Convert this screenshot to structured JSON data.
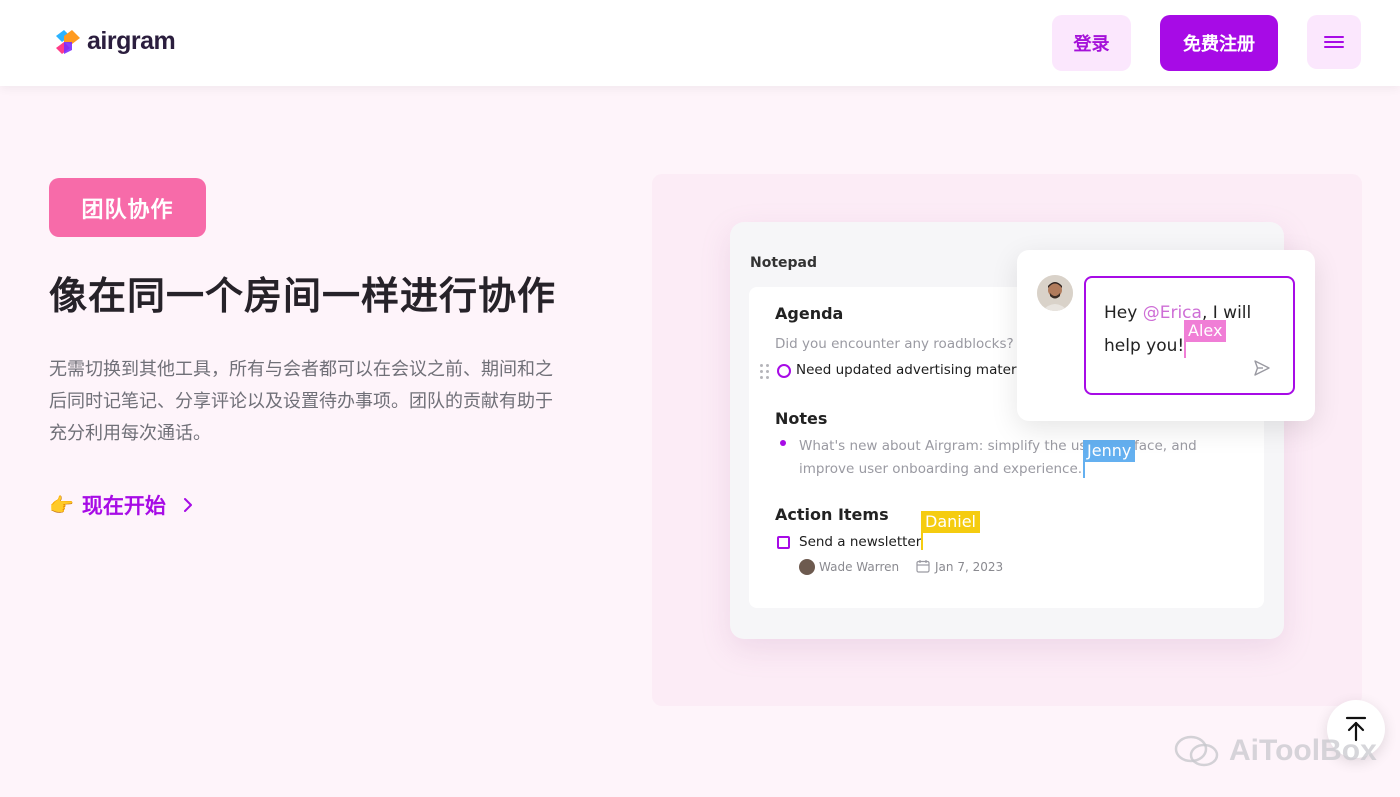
{
  "header": {
    "logo_text": "airgram",
    "login_label": "登录",
    "register_label": "免费注册",
    "menu_icon": "hamburger-menu-icon"
  },
  "hero": {
    "tag": "团队协作",
    "title": "像在同一个房间一样进行协作",
    "description": "无需切换到其他工具，所有与会者都可以在会议之前、期间和之后同时记笔记、分享评论以及设置待办事项。团队的贡献有助于充分利用每次通话。",
    "cta_emoji": "👉",
    "cta_label": "现在开始"
  },
  "notepad": {
    "title": "Notepad",
    "agenda": {
      "heading": "Agenda",
      "question": "Did you encounter any roadblocks?",
      "todo": "Need updated advertising mater"
    },
    "notes": {
      "heading": "Notes",
      "line1_a": "What's new about Airgram: simplify the us",
      "line1_b": "face, and",
      "line2": "improve user onboarding and experience."
    },
    "action_items": {
      "heading": "Action Items",
      "item": "Send a newsletter",
      "assignee": "Wade Warren",
      "due_date": "Jan 7, 2023"
    }
  },
  "cursors": {
    "jenny": "Jenny",
    "daniel": "Daniel",
    "alex": "Alex"
  },
  "chat": {
    "prefix": "Hey ",
    "mention": "@Erica",
    "suffix": ", I will",
    "line2": "help you!"
  },
  "watermark": "AiToolBox",
  "colors": {
    "brand_purple": "#a70be6",
    "tag_pink": "#f76ba9",
    "jenny_blue": "#64b0f0",
    "daniel_yellow": "#f5cc10",
    "alex_pink": "#f07ed6"
  }
}
